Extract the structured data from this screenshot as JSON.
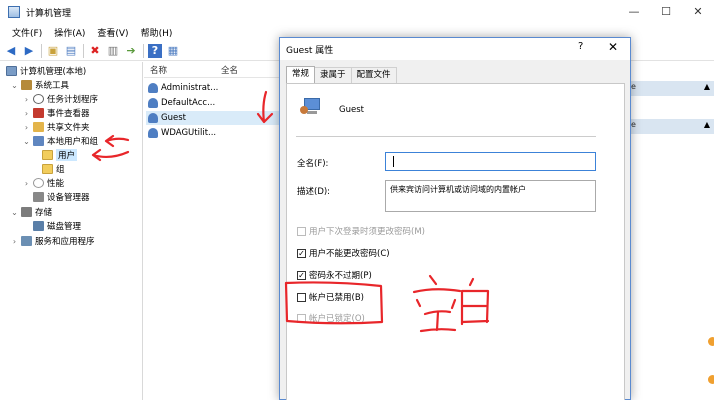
{
  "window": {
    "title": "计算机管理"
  },
  "menu": [
    "文件(F)",
    "操作(A)",
    "查看(V)",
    "帮助(H)"
  ],
  "tree": [
    {
      "label": "计算机管理(本地)",
      "icon": "computer-icon"
    },
    {
      "label": "系统工具",
      "icon": "tools-icon"
    },
    {
      "label": "任务计划程序",
      "icon": "clock-icon"
    },
    {
      "label": "事件查看器",
      "icon": "event-icon"
    },
    {
      "label": "共享文件夹",
      "icon": "share-icon"
    },
    {
      "label": "本地用户和组",
      "icon": "users-icon"
    },
    {
      "label": "用户",
      "icon": "folder-icon"
    },
    {
      "label": "组",
      "icon": "folder-icon"
    },
    {
      "label": "性能",
      "icon": "performance-icon"
    },
    {
      "label": "设备管理器",
      "icon": "device-icon"
    },
    {
      "label": "存储",
      "icon": "storage-icon"
    },
    {
      "label": "磁盘管理",
      "icon": "disk-icon"
    },
    {
      "label": "服务和应用程序",
      "icon": "services-icon"
    }
  ],
  "list": {
    "headers": [
      "名称",
      "全名"
    ],
    "rows": [
      "Administrat...",
      "DefaultAcc...",
      "Guest",
      "WDAGUtilit..."
    ]
  },
  "actions": {
    "bar1": "e",
    "bar2": "e"
  },
  "dialog": {
    "title": "Guest 属性",
    "help": "?",
    "close": "✕",
    "tabs": [
      "常规",
      "隶属于",
      "配置文件"
    ],
    "username": "Guest",
    "fullname_label": "全名(F):",
    "fullname_value": "",
    "desc_label": "描述(D):",
    "desc_value": "供来宾访问计算机或访问域的内置帐户",
    "checkboxes": [
      {
        "label": "用户下次登录时须更改密码(M)",
        "checked": false,
        "disabled": true
      },
      {
        "label": "用户不能更改密码(C)",
        "checked": true,
        "disabled": false
      },
      {
        "label": "密码永不过期(P)",
        "checked": true,
        "disabled": false
      },
      {
        "label": "帐户已禁用(B)",
        "checked": false,
        "disabled": false
      },
      {
        "label": "帐户已锁定(O)",
        "checked": false,
        "disabled": true
      }
    ]
  },
  "annotation": {
    "text": "空白",
    "color": "#e8262a"
  }
}
